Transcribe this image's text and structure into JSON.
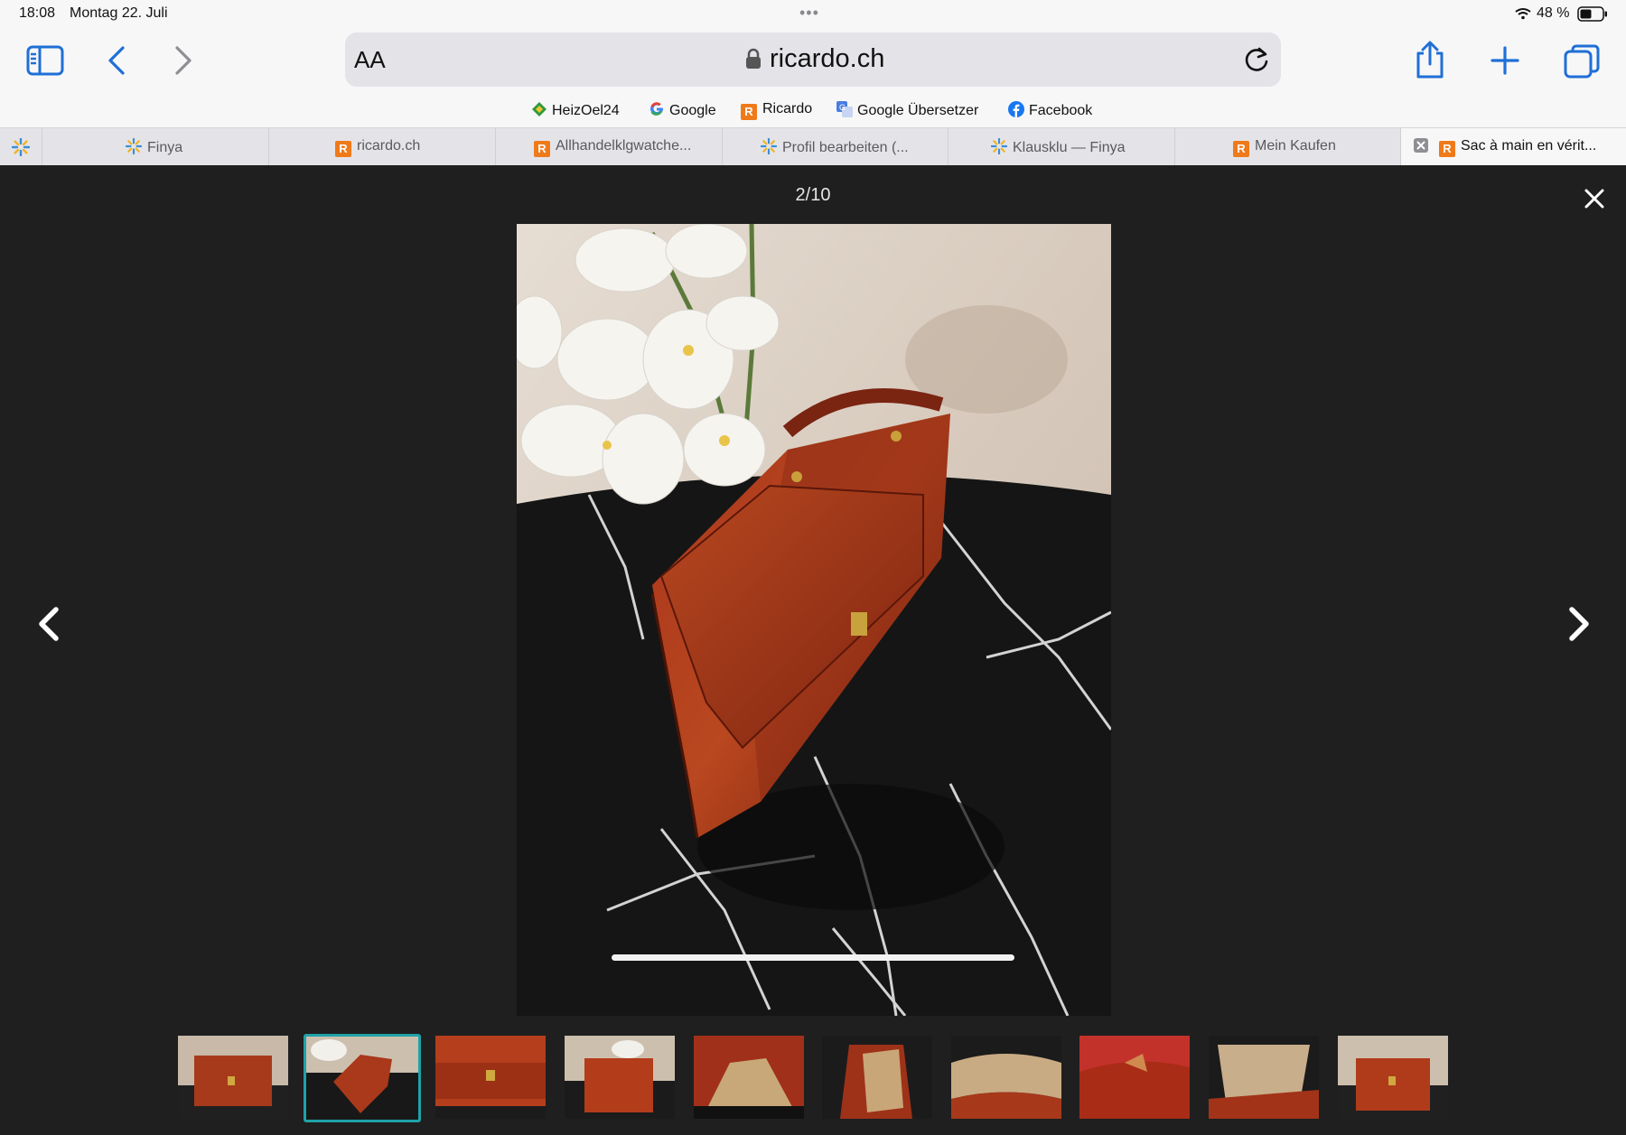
{
  "status_bar": {
    "time": "18:08",
    "date": "Montag 22. Juli",
    "battery": "48 %"
  },
  "address_bar": {
    "text_size_label": "AA",
    "host": "ricardo.ch"
  },
  "favorites": [
    {
      "label": "HeizOel24",
      "icon": "heizoel-diamond-icon",
      "color": "#2e9a3a"
    },
    {
      "label": "Google",
      "icon": "google-g-icon"
    },
    {
      "label": "Ricardo",
      "icon": "ricardo-icon",
      "color": "#ef7a1a"
    },
    {
      "label": "Google Übersetzer",
      "icon": "translate-icon",
      "color": "#4a7de0"
    },
    {
      "label": "Facebook",
      "icon": "facebook-icon",
      "color": "#1877f2"
    }
  ],
  "tabs": [
    {
      "label": "",
      "icon": "finya-icon"
    },
    {
      "label": "Finya",
      "icon": "finya-icon"
    },
    {
      "label": "ricardo.ch",
      "icon": "ricardo-icon"
    },
    {
      "label": "Allhandelklgwatche...",
      "icon": "ricardo-icon"
    },
    {
      "label": "Profil bearbeiten (...",
      "icon": "finya-icon"
    },
    {
      "label": "Klausklu — Finya",
      "icon": "finya-icon"
    },
    {
      "label": "Mein Kaufen",
      "icon": "ricardo-icon"
    },
    {
      "label": "Sac à main en vérit...",
      "icon": "ricardo-icon",
      "active": true
    }
  ],
  "gallery": {
    "counter": "2/10",
    "current_index": 2,
    "total": 10,
    "selected_thumb_color": "#1fa2a8"
  }
}
